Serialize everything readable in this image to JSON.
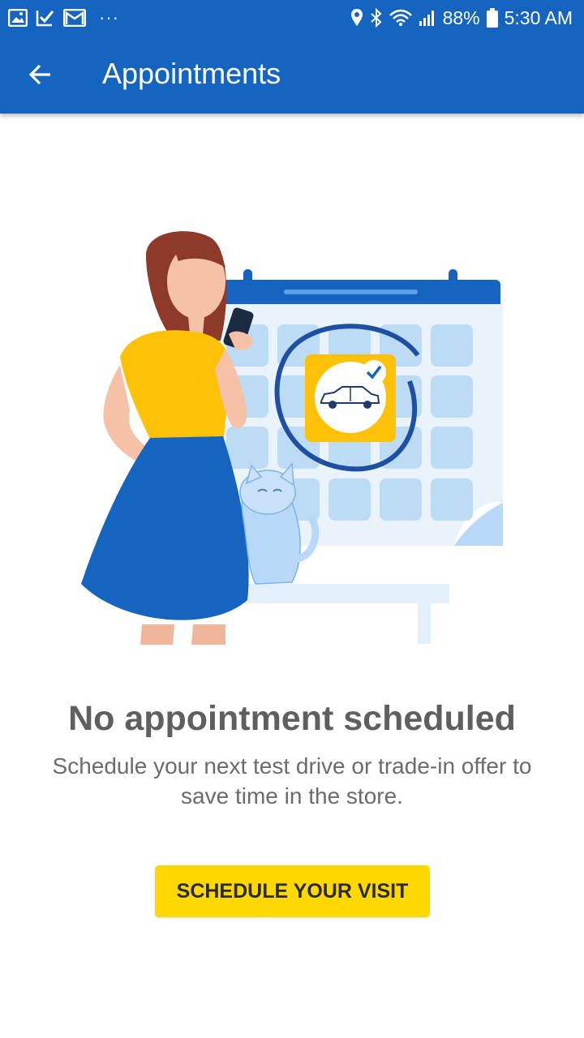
{
  "status_bar": {
    "battery": "88%",
    "time": "5:30 AM",
    "overflow": "···",
    "icons_left": [
      "image-icon",
      "check-icon",
      "mail-icon"
    ],
    "icons_right": [
      "location-icon",
      "bluetooth-icon",
      "wifi-icon",
      "signal-icon",
      "battery-icon"
    ]
  },
  "app_bar": {
    "title": "Appointments",
    "back_icon": "arrow-back-icon"
  },
  "empty_state": {
    "title": "No appointment scheduled",
    "description": "Schedule your next test drive or trade-in offer to save time in the store."
  },
  "cta": {
    "label": "SCHEDULE YOUR VISIT"
  },
  "colors": {
    "primary": "#1565c0",
    "accent": "#ffd800",
    "title_text": "#5f5f5f",
    "body_text": "#6b6b6b"
  }
}
